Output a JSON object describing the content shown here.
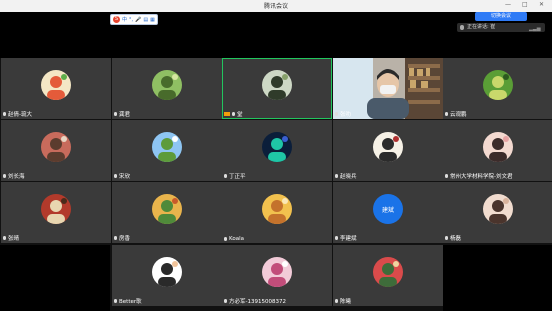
{
  "window": {
    "title": "腾讯会议"
  },
  "ime": {
    "items": [
      "中",
      "°,",
      "🎤",
      "▤",
      "▦"
    ]
  },
  "header": {
    "speed_label": "切换会议",
    "speaking_label": "正在讲话: 崔"
  },
  "participants": [
    {
      "name": "赵倩-琉大",
      "avatar": "snowman-cartoon"
    },
    {
      "name": "龚君",
      "avatar": "green-plants"
    },
    {
      "name": "堂",
      "avatar": "green-landscape",
      "active": true,
      "sharing": true
    },
    {
      "name": "张叻",
      "avatar": "video-man-mask"
    },
    {
      "name": "云观鹏",
      "avatar": "green-field"
    },
    {
      "name": "刘长海",
      "avatar": "people-photo"
    },
    {
      "name": "宋欣",
      "avatar": "sky-field"
    },
    {
      "name": "丁正平",
      "avatar": "aurora"
    },
    {
      "name": "赵晓兵",
      "avatar": "calligraphy"
    },
    {
      "name": "常州大学材料学院-刘文君",
      "avatar": "woman-photo"
    },
    {
      "name": "张晴",
      "avatar": "red-gate"
    },
    {
      "name": "房香",
      "avatar": "flower-field"
    },
    {
      "name": "Koala",
      "avatar": "child-yellow"
    },
    {
      "name": "李建斌",
      "avatar": "text",
      "avatar_text": "建斌"
    },
    {
      "name": "杨磊",
      "avatar": "woman-smile"
    },
    {
      "name": "Better耿",
      "avatar": "cartoon-boy"
    },
    {
      "name": "方必军-13915008372",
      "avatar": "pink-ball"
    },
    {
      "name": "陈曦",
      "avatar": "people-field"
    }
  ]
}
